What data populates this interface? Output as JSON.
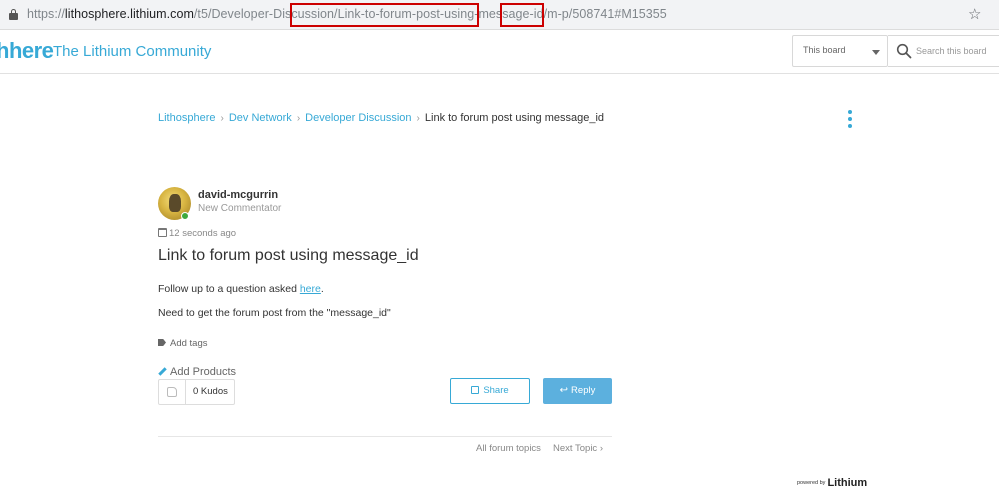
{
  "browser": {
    "url_prefix": "https://",
    "url_host": "lithosphere.lithium.com",
    "url_path_a": "/t5/Developer-Discussion/",
    "url_path_slug": "Link-to-forum-post-using-message-id",
    "url_path_b": "/m-p/",
    "url_path_id": "508741",
    "url_path_c": "#M15355",
    "highlight_color": "#cc0000"
  },
  "header": {
    "logo_text": "hhere",
    "community_name": "The Lithium Community",
    "scope_label": "This board",
    "search_placeholder": "Search this board",
    "brand_color": "#37a9d6"
  },
  "breadcrumb": {
    "items": [
      "Lithosphere",
      "Dev Network",
      "Developer Discussion"
    ],
    "current": "Link to forum post using message_id"
  },
  "post": {
    "author": "david-mcgurrin",
    "rank": "New Commentator",
    "time": "12 seconds ago",
    "subject": "Link to forum post using message_id",
    "body_line1_prefix": "Follow up to a question asked ",
    "body_line1_link": "here",
    "body_line1_suffix": ".",
    "body_line2": "Need to get the forum post from the \"message_id\"",
    "add_tags": "Add tags",
    "add_products": "Add Products",
    "kudos": "0 Kudos"
  },
  "actions": {
    "share": "Share",
    "reply": "Reply"
  },
  "footer": {
    "all_forum_topics": "All forum topics",
    "next_topic": "Next Topic",
    "powered_by": "powered by",
    "powered_brand": "Lithium"
  }
}
